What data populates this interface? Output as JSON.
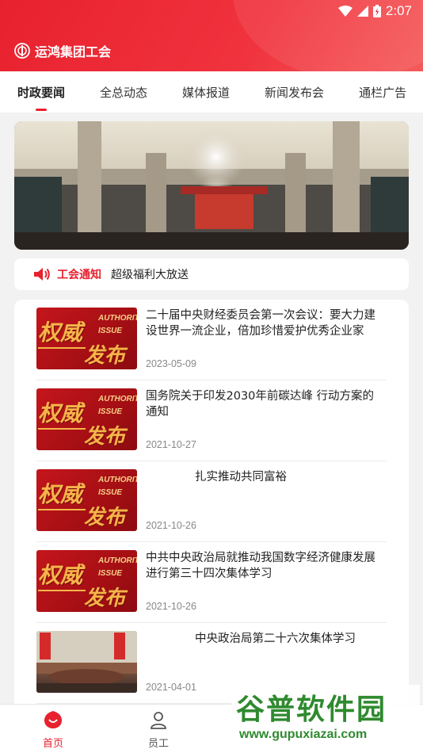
{
  "status_bar": {
    "time": "2:07"
  },
  "app": {
    "title": "运鸿集团工会"
  },
  "tabs": [
    {
      "label": "时政要闻",
      "active": true
    },
    {
      "label": "全总动态",
      "active": false
    },
    {
      "label": "媒体报道",
      "active": false
    },
    {
      "label": "新闻发布会",
      "active": false
    },
    {
      "label": "通栏广告",
      "active": false
    }
  ],
  "notice": {
    "label": "工会通知",
    "text": "超级福利大放送"
  },
  "thumb_text": {
    "big1": "权威",
    "big2": "发布",
    "en1": "AUTHORITY",
    "en2": "ISSUE"
  },
  "news": [
    {
      "title": "二十届中央财经委员会第一次会议：要大力建设世界一流企业，倍加珍惜爱护优秀企业家",
      "date": "2023-05-09",
      "thumb": "authority"
    },
    {
      "title": "国务院关于印发2030年前碳达峰 行动方案的通知",
      "date": "2021-10-27",
      "thumb": "authority"
    },
    {
      "title": "扎实推动共同富裕",
      "date": "2021-10-26",
      "thumb": "authority"
    },
    {
      "title": "中共中央政治局就推动我国数字经济健康发展进行第三十四次集体学习",
      "date": "2021-10-26",
      "thumb": "authority"
    },
    {
      "title": "中央政治局第二十六次集体学习",
      "date": "2021-04-01",
      "thumb": "meeting"
    }
  ],
  "tabbar": [
    {
      "label": "首页",
      "active": true
    },
    {
      "label": "员工",
      "active": false
    }
  ],
  "watermark": {
    "line1": "谷普软件园",
    "line2": "www.gupuxiazai.com"
  },
  "colors": {
    "brand_red": "#e8212e",
    "gold": "#f5b54a"
  }
}
